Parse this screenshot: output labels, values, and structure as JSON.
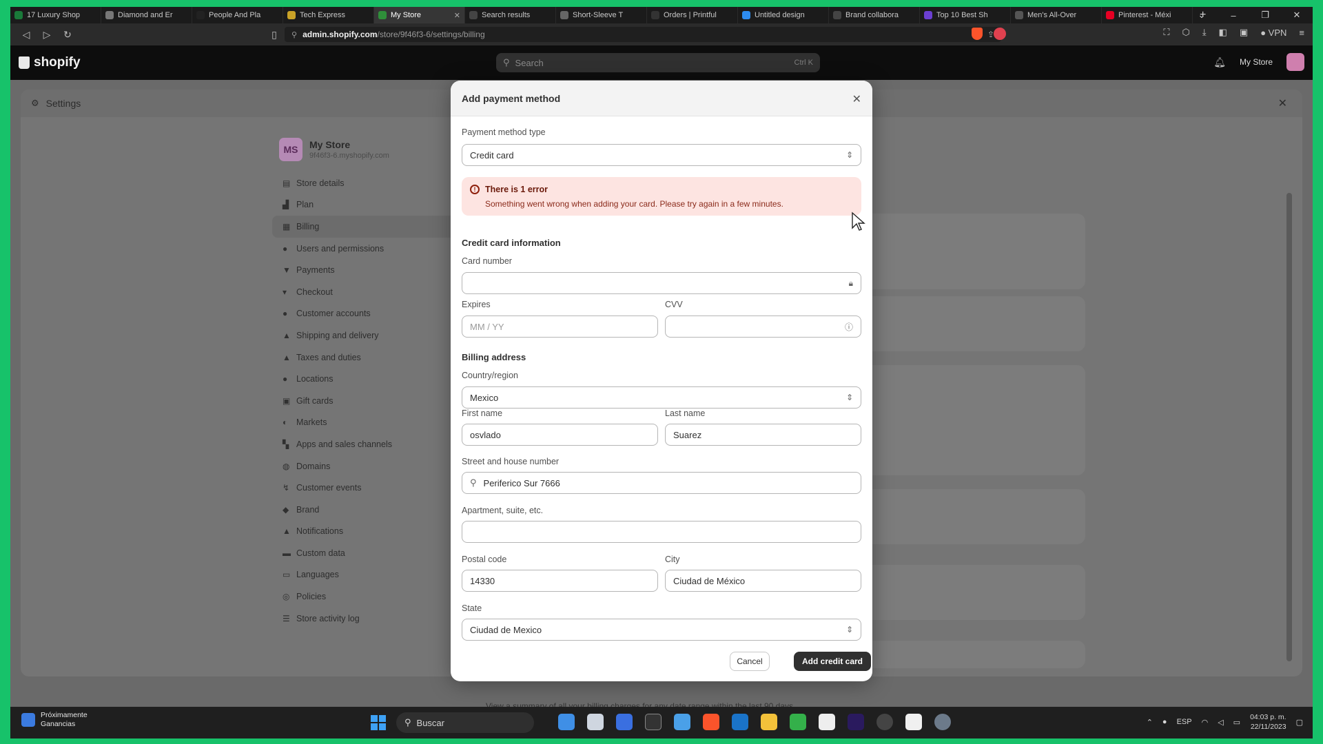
{
  "browser": {
    "tabs": [
      {
        "label": "17 Luxury Shop",
        "color": "#1a7a3a"
      },
      {
        "label": "Diamond and Er",
        "color": "#777777"
      },
      {
        "label": "People And Pla",
        "color": "#222222"
      },
      {
        "label": "Tech Express",
        "color": "#c9a227"
      },
      {
        "label": "My Store",
        "color": "#2f8f3a",
        "active": true
      },
      {
        "label": "Search results",
        "color": "#444444"
      },
      {
        "label": "Short-Sleeve T",
        "color": "#666666"
      },
      {
        "label": "Orders | Printful",
        "color": "#333333"
      },
      {
        "label": "Untitled design",
        "color": "#2d8cf0"
      },
      {
        "label": "Brand collabora",
        "color": "#444444"
      },
      {
        "label": "Top 10 Best Sh",
        "color": "#6b3fd1"
      },
      {
        "label": "Men's All-Over",
        "color": "#555555"
      },
      {
        "label": "Pinterest - Méxi",
        "color": "#e60023"
      }
    ],
    "new_tab": "+",
    "url_host": "admin.shopify.com",
    "url_path": "/store/9f46f3-6/settings/billing",
    "vpn_label": "VPN"
  },
  "shopify": {
    "logo_text": "shopify",
    "search_placeholder": "Search",
    "search_shortcut": "Ctrl K",
    "store_label": "My Store"
  },
  "settings": {
    "title": "Settings",
    "store_initials": "MS",
    "store_name": "My Store",
    "store_url": "9f46f3-6.myshopify.com",
    "nav": [
      {
        "label": "Store details",
        "icon": "store-icon",
        "glyph": "▤"
      },
      {
        "label": "Plan",
        "icon": "plan-icon",
        "glyph": "▟"
      },
      {
        "label": "Billing",
        "icon": "billing-icon",
        "glyph": "▦",
        "selected": true
      },
      {
        "label": "Users and permissions",
        "icon": "users-icon",
        "glyph": "●"
      },
      {
        "label": "Payments",
        "icon": "payments-icon",
        "glyph": "▼"
      },
      {
        "label": "Checkout",
        "icon": "checkout-icon",
        "glyph": "▾"
      },
      {
        "label": "Customer accounts",
        "icon": "customer-icon",
        "glyph": "●"
      },
      {
        "label": "Shipping and delivery",
        "icon": "shipping-icon",
        "glyph": "▲"
      },
      {
        "label": "Taxes and duties",
        "icon": "taxes-icon",
        "glyph": "▲"
      },
      {
        "label": "Locations",
        "icon": "location-icon",
        "glyph": "●"
      },
      {
        "label": "Gift cards",
        "icon": "gift-icon",
        "glyph": "▣"
      },
      {
        "label": "Markets",
        "icon": "markets-icon",
        "glyph": "◐"
      },
      {
        "label": "Apps and sales channels",
        "icon": "apps-icon",
        "glyph": "▚"
      },
      {
        "label": "Domains",
        "icon": "domains-icon",
        "glyph": "◍"
      },
      {
        "label": "Customer events",
        "icon": "events-icon",
        "glyph": "↯"
      },
      {
        "label": "Brand",
        "icon": "brand-icon",
        "glyph": "◆"
      },
      {
        "label": "Notifications",
        "icon": "bell-icon",
        "glyph": "▲"
      },
      {
        "label": "Custom data",
        "icon": "data-icon",
        "glyph": "▬"
      },
      {
        "label": "Languages",
        "icon": "languages-icon",
        "glyph": "▭"
      },
      {
        "label": "Policies",
        "icon": "policies-icon",
        "glyph": "◎"
      },
      {
        "label": "Store activity log",
        "icon": "log-icon",
        "glyph": "☰"
      }
    ],
    "footnote": "View a summary of all your billing charges for any date range within the last 90 days."
  },
  "modal": {
    "title": "Add payment method",
    "payment_type_label": "Payment method type",
    "payment_type_value": "Credit card",
    "error_title": "There is 1 error",
    "error_message": "Something went wrong when adding your card. Please try again in a few minutes.",
    "card_section": "Credit card information",
    "card_number_label": "Card number",
    "card_number_value": "",
    "expires_label": "Expires",
    "expires_placeholder": "MM / YY",
    "cvv_label": "CVV",
    "cvv_value": "",
    "billing_section": "Billing address",
    "country_label": "Country/region",
    "country_value": "Mexico",
    "first_name_label": "First name",
    "first_name_value": "osvlado",
    "last_name_label": "Last name",
    "last_name_value": "Suarez",
    "street_label": "Street and house number",
    "street_value": "Periferico Sur 7666",
    "apt_label": "Apartment, suite, etc.",
    "apt_value": "",
    "postal_label": "Postal code",
    "postal_value": "14330",
    "city_label": "City",
    "city_value": "Ciudad de México",
    "state_label": "State",
    "state_value": "Ciudad de Mexico",
    "cancel_label": "Cancel",
    "submit_label": "Add credit card"
  },
  "taskbar": {
    "weather_line1": "Próximamente",
    "weather_line2": "Ganancias",
    "search_label": "Buscar",
    "lang": "ESP",
    "time": "04:03 p. m.",
    "date": "22/11/2023"
  }
}
